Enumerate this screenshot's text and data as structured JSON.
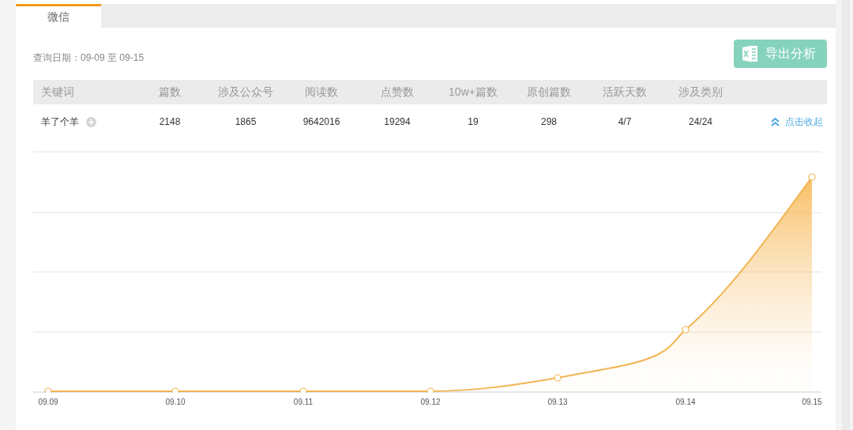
{
  "tabs": [
    {
      "label": "微信",
      "selected": true
    }
  ],
  "query_date": "查询日期：09-09 至 09-15",
  "export_button": "导出分析",
  "table": {
    "columns": [
      "关键词",
      "篇数",
      "涉及公众号",
      "阅读数",
      "点赞数",
      "10w+篇数",
      "原创篇数",
      "活跃天数",
      "涉及类别"
    ],
    "rows": [
      {
        "cells": [
          "羊了个羊",
          "2148",
          "1865",
          "9642016",
          "19294",
          "19",
          "298",
          "4/7",
          "24/24"
        ],
        "action": "点击收起"
      }
    ]
  },
  "trend": {
    "x_labels": [
      "09.09",
      "09.10",
      "09.11",
      "09.12",
      "09.13",
      "09.14",
      "09.15"
    ]
  }
}
